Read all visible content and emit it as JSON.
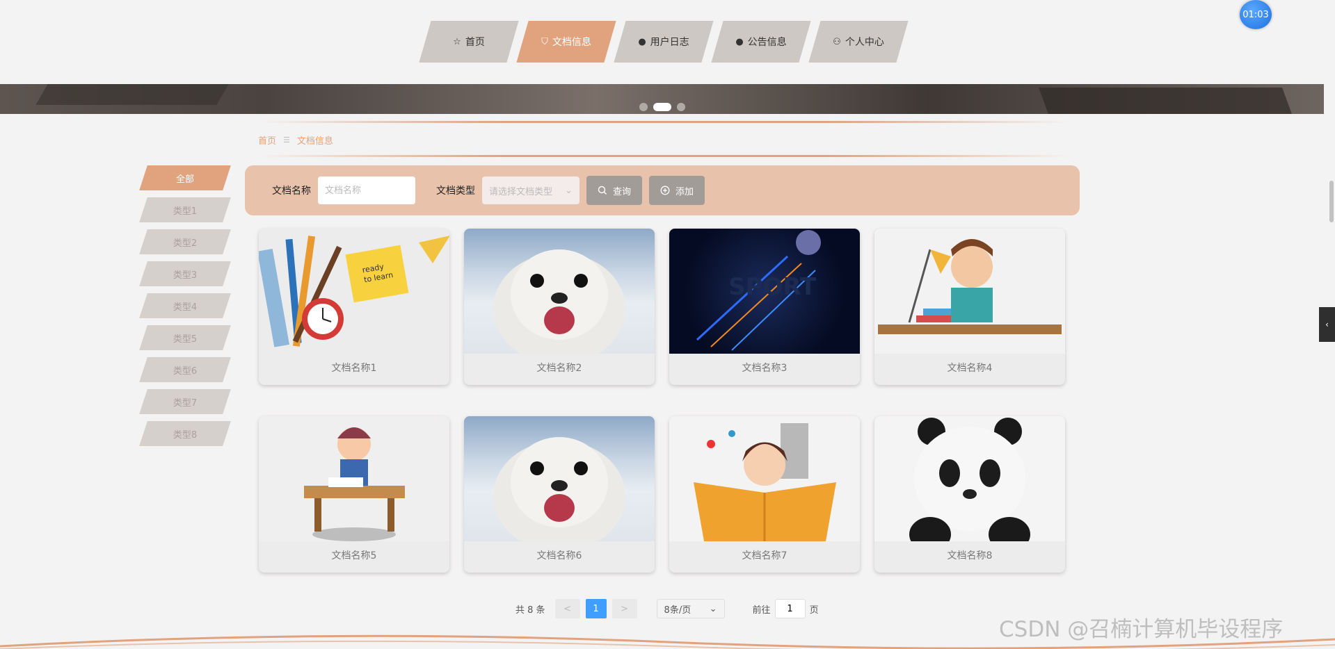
{
  "nav": {
    "items": [
      {
        "label": "首页",
        "icon": "star-icon",
        "glyph": "☆",
        "active": false
      },
      {
        "label": "文档信息",
        "icon": "bag-icon",
        "glyph": "⛉",
        "active": true
      },
      {
        "label": "用户日志",
        "icon": "info-icon",
        "glyph": "●",
        "active": false
      },
      {
        "label": "公告信息",
        "icon": "question-icon",
        "glyph": "●",
        "active": false
      },
      {
        "label": "个人中心",
        "icon": "user-icon",
        "glyph": "⚇",
        "active": false
      }
    ],
    "timer": "01:03"
  },
  "breadcrumb": {
    "home": "首页",
    "separator": "☰",
    "current": "文档信息"
  },
  "sidebar": {
    "items": [
      "全部",
      "类型1",
      "类型2",
      "类型3",
      "类型4",
      "类型5",
      "类型6",
      "类型7",
      "类型8"
    ],
    "active_index": 0
  },
  "search": {
    "name_label": "文档名称",
    "name_placeholder": "文档名称",
    "type_label": "文档类型",
    "type_placeholder": "请选择文档类型",
    "query_label": "查询",
    "add_label": "添加"
  },
  "cards": [
    {
      "title": "文档名称1",
      "image": "school-supplies"
    },
    {
      "title": "文档名称2",
      "image": "seal"
    },
    {
      "title": "文档名称3",
      "image": "sport"
    },
    {
      "title": "文档名称4",
      "image": "boy-studying"
    },
    {
      "title": "文档名称5",
      "image": "boy-desk"
    },
    {
      "title": "文档名称6",
      "image": "seal"
    },
    {
      "title": "文档名称7",
      "image": "girl-reading"
    },
    {
      "title": "文档名称8",
      "image": "panda"
    }
  ],
  "pagination": {
    "total": "共 8 条",
    "prev": "<",
    "current": "1",
    "next": ">",
    "page_size": "8条/页",
    "goto_prefix": "前往",
    "goto_value": "1",
    "goto_suffix": "页"
  },
  "watermark": "CSDN @召楠计算机毕设程序",
  "colors": {
    "accent": "#e0a37e",
    "primary": "#409eff"
  }
}
